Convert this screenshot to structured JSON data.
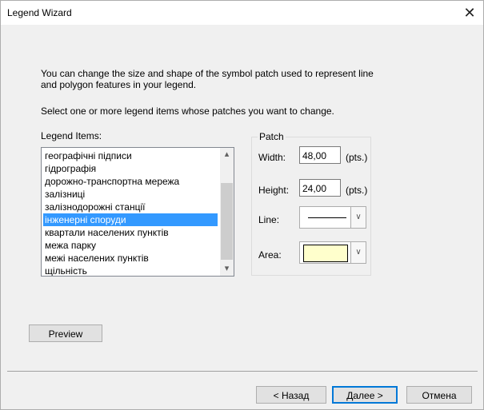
{
  "window": {
    "title": "Legend Wizard",
    "close_glyph": "✕"
  },
  "intro": {
    "line1": "You can change the size and shape of the symbol patch used to represent line",
    "line2": "and polygon features in your legend.",
    "select_text": "Select one or more legend items whose patches you want to change."
  },
  "legend_items": {
    "label": "Legend Items:",
    "items": [
      "географічні підписи",
      "гідрографія",
      "дорожно-транспортна мережа",
      "залізниці",
      "залізнодорожні станції",
      "інженерні споруди",
      "квартали населених пунктів",
      "межа парку",
      "межі населених пунктів",
      "щільність"
    ],
    "selected_index": 5,
    "scroll_up_glyph": "▴",
    "scroll_down_glyph": "▾"
  },
  "patch": {
    "group_label": "Patch",
    "width_label": "Width:",
    "width_value": "48,00",
    "width_unit": "(pts.)",
    "height_label": "Height:",
    "height_value": "24,00",
    "height_unit": "(pts.)",
    "line_label": "Line:",
    "area_label": "Area:",
    "area_color": "#ffffcc",
    "combo_arrow_glyph": "∨"
  },
  "buttons": {
    "preview": "Preview",
    "back": "< Назад",
    "next": "Далее >",
    "cancel": "Отмена"
  },
  "colors": {
    "selection": "#3399ff",
    "default_button_border": "#0078d7"
  }
}
